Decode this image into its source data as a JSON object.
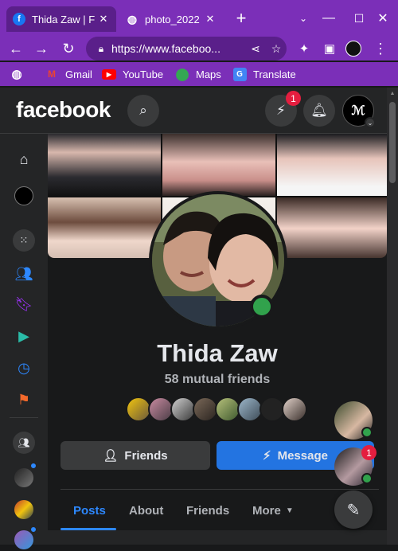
{
  "browser": {
    "tabs": [
      {
        "title": "Thida Zaw | F",
        "favicon": "facebook-icon",
        "active": true
      },
      {
        "title": "photo_2022",
        "favicon": "globe-icon",
        "active": false
      }
    ],
    "new_tab_label": "+",
    "url": "https://www.faceboo...",
    "bookmarks": [
      {
        "label": "Gmail",
        "icon": "gmail-icon"
      },
      {
        "label": "YouTube",
        "icon": "youtube-icon"
      },
      {
        "label": "Maps",
        "icon": "maps-icon"
      },
      {
        "label": "Translate",
        "icon": "translate-icon"
      }
    ]
  },
  "facebook": {
    "logo": "facebook",
    "messenger_badge": "1",
    "profile": {
      "name": "Thida Zaw",
      "mutual_friends": "58 mutual friends",
      "online": true
    },
    "actions": {
      "friends_label": "Friends",
      "message_label": "Message"
    },
    "tabs": [
      {
        "label": "Posts",
        "active": true
      },
      {
        "label": "About",
        "active": false
      },
      {
        "label": "Friends",
        "active": false
      },
      {
        "label": "More",
        "active": false
      }
    ],
    "chat_badge": "1"
  },
  "colors": {
    "browser_accent": "#7b2fb8",
    "fb_blue": "#2d88ff",
    "message_button": "#2374e1",
    "online_green": "#31a24c",
    "badge_red": "#e41e3f"
  }
}
